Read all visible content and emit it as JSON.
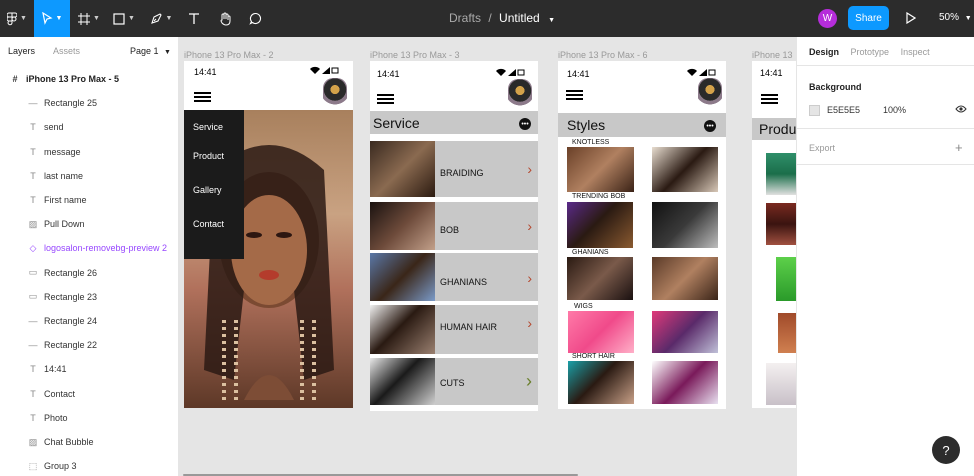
{
  "toolbar": {
    "doc_folder": "Drafts",
    "doc_sep": "/",
    "doc_name": "Untitled",
    "avatar_initial": "W",
    "share_label": "Share",
    "zoom_label": "50%"
  },
  "left_panel": {
    "tab_layers": "Layers",
    "tab_assets": "Assets",
    "page_selector": "Page 1",
    "layers": [
      {
        "label": "iPhone 13 Pro Max - 5",
        "icon": "#",
        "kind": "frame"
      },
      {
        "label": "Rectangle 25",
        "icon": "—",
        "kind": "line"
      },
      {
        "label": "send",
        "icon": "T",
        "kind": "text"
      },
      {
        "label": "message",
        "icon": "T",
        "kind": "text"
      },
      {
        "label": "last name",
        "icon": "T",
        "kind": "text"
      },
      {
        "label": "First name",
        "icon": "T",
        "kind": "text"
      },
      {
        "label": "Pull Down",
        "icon": "▨",
        "kind": "image"
      },
      {
        "label": "logosalon-removebg-preview 2",
        "icon": "◇",
        "kind": "component"
      },
      {
        "label": "Rectangle 26",
        "icon": "▭",
        "kind": "rect"
      },
      {
        "label": "Rectangle 23",
        "icon": "▭",
        "kind": "rect"
      },
      {
        "label": "Rectangle 24",
        "icon": "—",
        "kind": "line"
      },
      {
        "label": "Rectangle 22",
        "icon": "—",
        "kind": "line"
      },
      {
        "label": "14:41",
        "icon": "T",
        "kind": "text"
      },
      {
        "label": "Contact",
        "icon": "T",
        "kind": "text"
      },
      {
        "label": "Photo",
        "icon": "T",
        "kind": "text"
      },
      {
        "label": "Chat Bubble",
        "icon": "▨",
        "kind": "image"
      },
      {
        "label": "Group 3",
        "icon": "⬚",
        "kind": "group"
      }
    ]
  },
  "right_panel": {
    "tab_design": "Design",
    "tab_prototype": "Prototype",
    "tab_inspect": "Inspect",
    "background_label": "Background",
    "background_hex": "E5E5E5",
    "background_opacity": "100%",
    "export_label": "Export"
  },
  "help_label": "?",
  "frames": {
    "f2": {
      "label": "iPhone 13 Pro Max - 2",
      "time": "14:41",
      "menu": [
        "Service",
        "Product",
        "Gallery",
        "Contact"
      ]
    },
    "f3": {
      "label": "iPhone 13 Pro Max - 3",
      "time": "14:41",
      "title": "Service",
      "services": [
        {
          "label": "BRAIDING",
          "arrow": "›"
        },
        {
          "label": "BOB",
          "arrow": "›"
        },
        {
          "label": "GHANIANS",
          "arrow": "›"
        },
        {
          "label": "HUMAN HAIR",
          "arrow": "›"
        },
        {
          "label": "CUTS",
          "arrow": "›"
        }
      ]
    },
    "f6": {
      "label": "iPhone 13 Pro Max - 6",
      "time": "14:41",
      "title": "Styles",
      "styles": [
        "KNOTLESS",
        "TRENDING BOB",
        "GHANIANS",
        "WIGS",
        "SHORT HAIR"
      ]
    },
    "f4": {
      "label": "iPhone 13",
      "time": "14:41",
      "title": "Produ"
    }
  },
  "colors": {
    "accent": "#0d99ff",
    "toolbar_bg": "#2c2c2c",
    "canvas_bg": "#e5e5e5",
    "component_purple": "#9747ff"
  }
}
